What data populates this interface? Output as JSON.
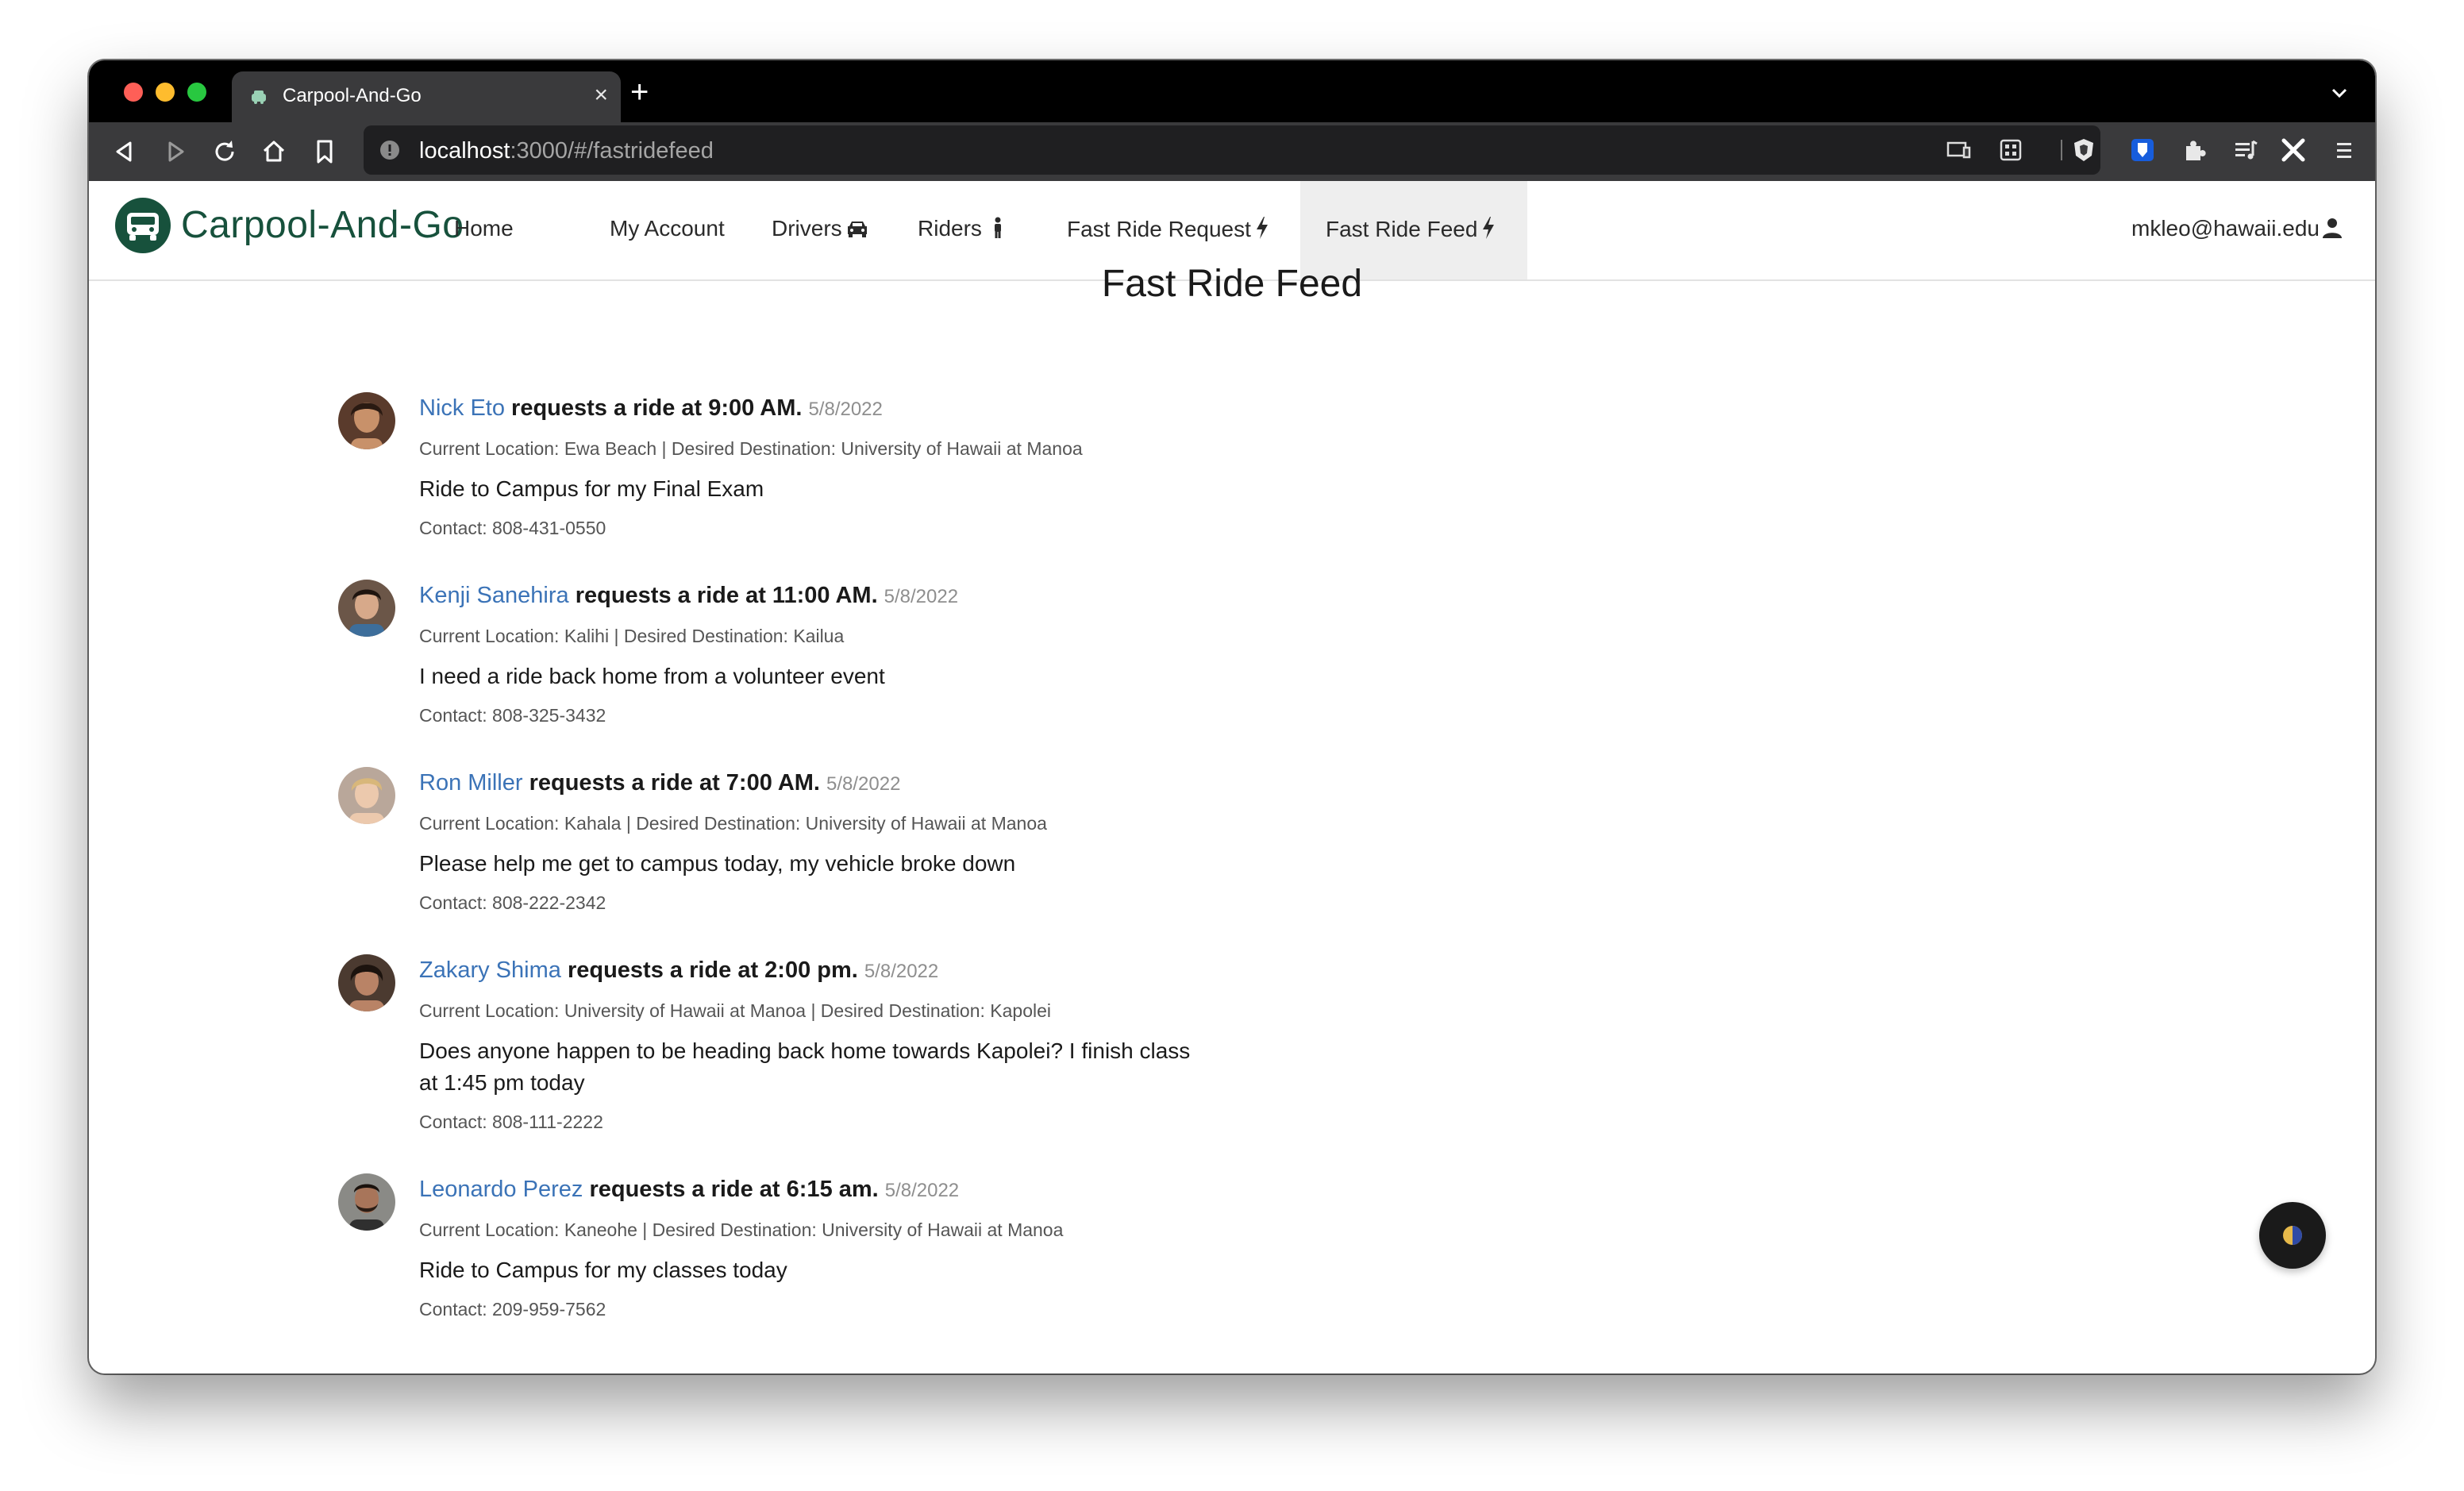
{
  "browser": {
    "tab_title": "Carpool-And-Go",
    "url_host": "localhost",
    "url_path": ":3000/#/fastridefeed"
  },
  "navbar": {
    "brand": "Carpool-And-Go",
    "links": [
      {
        "label": "Home"
      },
      {
        "label": "My Account"
      },
      {
        "label": "Drivers"
      },
      {
        "label": "Riders"
      },
      {
        "label": "Fast Ride Request"
      },
      {
        "label": "Fast Ride Feed"
      }
    ],
    "active": "Fast Ride Feed",
    "user": "mkleo@hawaii.edu"
  },
  "page": {
    "title": "Fast Ride Feed"
  },
  "feed": [
    {
      "name": "Nick Eto",
      "request": "requests a ride at 9:00 AM.",
      "date": "5/8/2022",
      "location": "Current Location: Ewa Beach | Desired Destination: University of Hawaii at Manoa",
      "description": "Ride to Campus for my Final Exam",
      "contact": "Contact: 808-431-0550"
    },
    {
      "name": "Kenji Sanehira",
      "request": "requests a ride at 11:00 AM.",
      "date": "5/8/2022",
      "location": "Current Location: Kalihi | Desired Destination: Kailua",
      "description": "I need a ride back home from a volunteer event",
      "contact": "Contact: 808-325-3432"
    },
    {
      "name": "Ron Miller",
      "request": "requests a ride at 7:00 AM.",
      "date": "5/8/2022",
      "location": "Current Location: Kahala | Desired Destination: University of Hawaii at Manoa",
      "description": "Please help me get to campus today, my vehicle broke down",
      "contact": "Contact: 808-222-2342"
    },
    {
      "name": "Zakary Shima",
      "request": "requests a ride at 2:00 pm.",
      "date": "5/8/2022",
      "location": "Current Location: University of Hawaii at Manoa | Desired Destination: Kapolei",
      "description": "Does anyone happen to be heading back home towards Kapolei? I finish class at 1:45 pm today",
      "contact": "Contact: 808-111-2222"
    },
    {
      "name": "Leonardo Perez",
      "request": "requests a ride at 6:15 am.",
      "date": "5/8/2022",
      "location": "Current Location: Kaneohe | Desired Destination: University of Hawaii at Manoa",
      "description": "Ride to Campus for my classes today",
      "contact": "Contact: 209-959-7562"
    }
  ],
  "colors": {
    "brand": "#17513c",
    "link": "#3b73b7",
    "active_nav_bg": "#eeeeee"
  }
}
